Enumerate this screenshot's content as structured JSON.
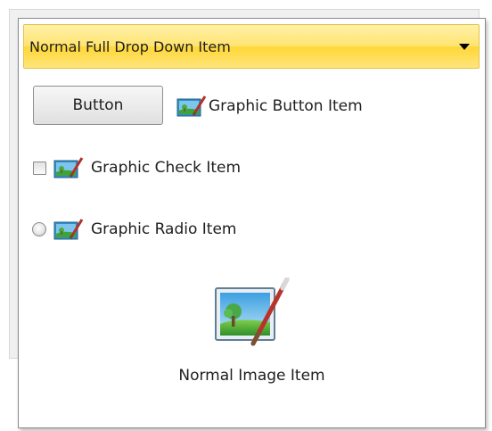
{
  "dropdown": {
    "label": "Normal Full Drop Down Item",
    "icon": "chevron-down-icon"
  },
  "button_item": {
    "button_label": "Button",
    "graphic_label": "Graphic Button Item",
    "icon": "picture-edit-icon"
  },
  "check_item": {
    "label": "Graphic Check Item",
    "checked": false,
    "icon": "picture-edit-icon"
  },
  "radio_item": {
    "label": "Graphic Radio Item",
    "selected": false,
    "icon": "picture-edit-icon"
  },
  "image_item": {
    "label": "Normal Image Item",
    "icon": "picture-edit-icon"
  },
  "colors": {
    "dropdown_highlight": "#ffd737",
    "menu_border": "#8a8a8a"
  }
}
